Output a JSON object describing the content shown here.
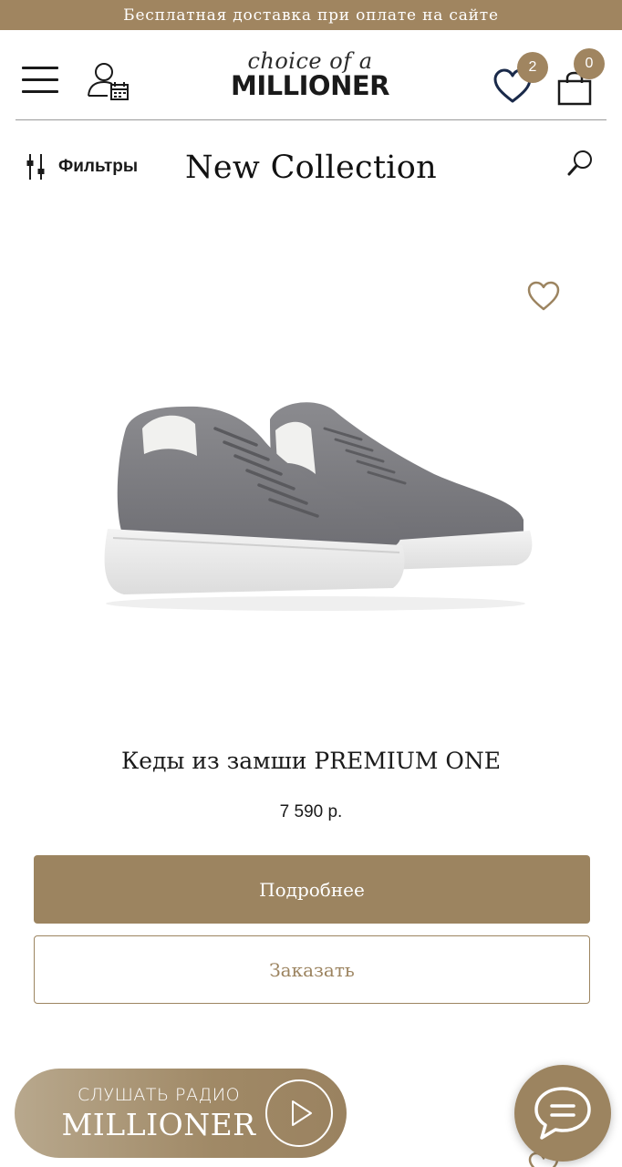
{
  "promo": {
    "text": "Бесплатная доставка при оплате на сайте"
  },
  "header": {
    "logo_script": "choice of a",
    "logo_main": "MILLIONER",
    "wishlist_count": "2",
    "cart_count": "0"
  },
  "toolbar": {
    "filters_label": "Фильтры",
    "page_title": "New Collection"
  },
  "product": {
    "name": "Кеды из замши PREMIUM ONE",
    "price": "7 590 р.",
    "details_label": "Подробнее",
    "order_label": "Заказать"
  },
  "radio": {
    "top_text": "СЛУШАТЬ РАДИО",
    "main_text": "MILLIONER"
  },
  "colors": {
    "accent": "#a08560",
    "text": "#1a1a1a",
    "background": "#ffffff"
  },
  "icons": [
    "menu-icon",
    "account-calendar-icon",
    "heart-icon",
    "bag-icon",
    "filter-sliders-icon",
    "search-icon",
    "play-icon",
    "chat-icon"
  ]
}
